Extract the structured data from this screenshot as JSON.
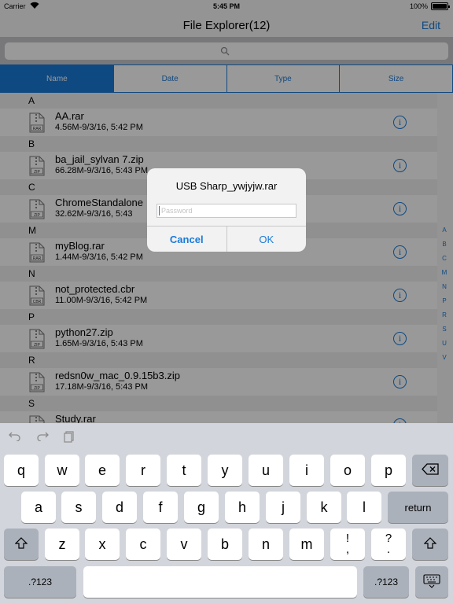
{
  "statusbar": {
    "carrier": "Carrier",
    "time": "5:45 PM",
    "battery_pct": "100%",
    "battery_level": 1.0
  },
  "navbar": {
    "title": "File Explorer(12)",
    "edit_label": "Edit"
  },
  "search": {
    "placeholder": ""
  },
  "segments": [
    {
      "label": "Name",
      "active": true
    },
    {
      "label": "Date",
      "active": false
    },
    {
      "label": "Type",
      "active": false
    },
    {
      "label": "Size",
      "active": false
    }
  ],
  "sections": [
    {
      "letter": "A",
      "files": [
        {
          "name": "AA.rar",
          "meta": "4.56M-9/3/16, 5:42 PM",
          "icon": "RAR"
        }
      ]
    },
    {
      "letter": "B",
      "files": [
        {
          "name": "ba_jail_sylvan 7.zip",
          "meta": "66.28M-9/3/16, 5:43 PM",
          "icon": "ZIP"
        }
      ]
    },
    {
      "letter": "C",
      "files": [
        {
          "name": "ChromeStandalone",
          "meta": "32.62M-9/3/16, 5:43",
          "icon": "ZIP"
        }
      ]
    },
    {
      "letter": "M",
      "files": [
        {
          "name": "myBlog.rar",
          "meta": "1.44M-9/3/16, 5:42 PM",
          "icon": "RAR"
        }
      ]
    },
    {
      "letter": "N",
      "files": [
        {
          "name": "not_protected.cbr",
          "meta": "11.00M-9/3/16, 5:42 PM",
          "icon": "CBR"
        }
      ]
    },
    {
      "letter": "P",
      "files": [
        {
          "name": "python27.zip",
          "meta": "1.65M-9/3/16, 5:43 PM",
          "icon": "ZIP"
        }
      ]
    },
    {
      "letter": "R",
      "files": [
        {
          "name": "redsn0w_mac_0.9.15b3.zip",
          "meta": "17.18M-9/3/16, 5:43 PM",
          "icon": "ZIP"
        }
      ]
    },
    {
      "letter": "S",
      "files": [
        {
          "name": "Study.rar",
          "meta": "",
          "icon": "RAR"
        }
      ]
    }
  ],
  "index": [
    "A",
    "B",
    "C",
    "M",
    "N",
    "P",
    "R",
    "S",
    "U",
    "V"
  ],
  "alert": {
    "title": "USB Sharp_ywjyjw.rar",
    "placeholder": "Password",
    "cancel_label": "Cancel",
    "ok_label": "OK"
  },
  "keyboard": {
    "row1": [
      "q",
      "w",
      "e",
      "r",
      "t",
      "y",
      "u",
      "i",
      "o",
      "p"
    ],
    "row2": [
      "a",
      "s",
      "d",
      "f",
      "g",
      "h",
      "j",
      "k",
      "l"
    ],
    "return_label": "return",
    "row3": [
      "z",
      "x",
      "c",
      "v",
      "b",
      "n",
      "m"
    ],
    "punct1": [
      "!",
      ","
    ],
    "punct2": [
      "?",
      "."
    ],
    "numbers_label": ".?123"
  },
  "colors": {
    "accent": "#1a7ad8"
  }
}
